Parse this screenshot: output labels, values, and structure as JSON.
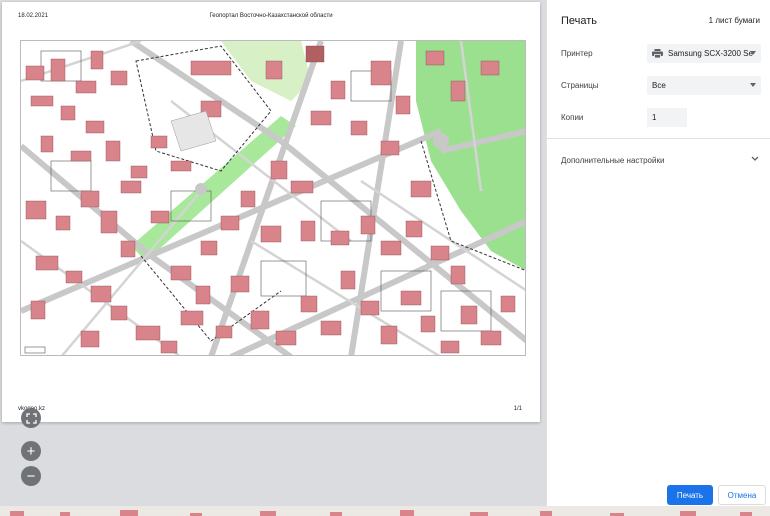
{
  "preview": {
    "header_date": "18.02.2021",
    "header_title": "Геопортал Восточно-Казахстанской области",
    "footer_url": "vkogeo.kz",
    "footer_page": "1/1",
    "fit_icon": "fit-to-page-icon",
    "zoom_in_label": "+",
    "zoom_out_label": "−"
  },
  "settings": {
    "title": "Печать",
    "sheets": "1 лист бумаги",
    "printer_label": "Принтер",
    "printer_value": "Samsung SCX-3200 Se",
    "printer_icon": "printer-icon",
    "pages_label": "Страницы",
    "pages_value": "Все",
    "copies_label": "Копии",
    "copies_value": "1",
    "more_settings_label": "Дополнительные настройки",
    "print_label": "Печать",
    "cancel_label": "Отмена"
  },
  "colors": {
    "accent": "#1a73e8",
    "map_building": "#d9848a",
    "map_green": "#9be08f",
    "map_road": "#c8c8c8"
  }
}
